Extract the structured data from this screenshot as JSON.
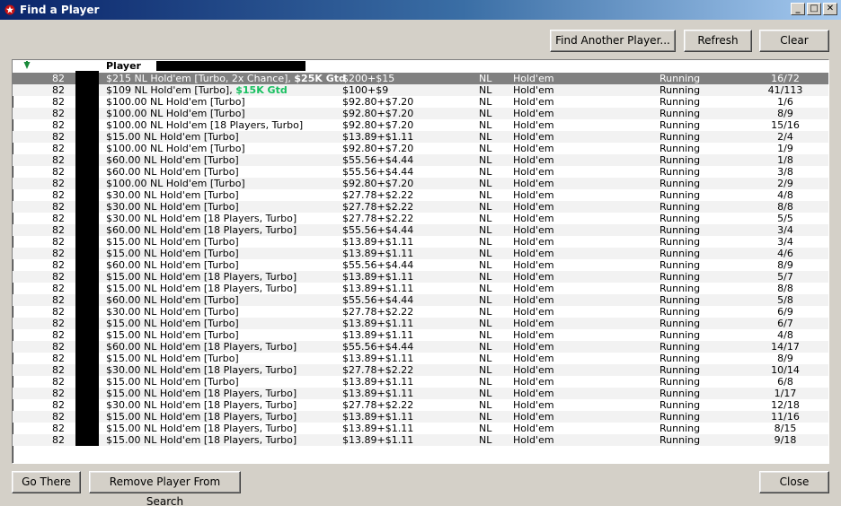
{
  "window": {
    "title": "Find a Player",
    "controls": {
      "minimize": "_",
      "maximize": "□",
      "close": "✕"
    }
  },
  "toolbar": {
    "find_another": "Find Another Player...",
    "refresh": "Refresh",
    "clear": "Clear"
  },
  "list": {
    "header": {
      "player": "Player"
    },
    "rows": [
      {
        "id": "82",
        "name": "$215 NL Hold'em [Turbo, 2x Chance],",
        "gtd": "$25K Gtd",
        "buyin": "$200+$15",
        "limit": "NL",
        "game": "Hold'em",
        "status": "Running",
        "entrants": "16/72",
        "selected": true
      },
      {
        "id": "82",
        "name": "$109 NL Hold'em [Turbo],",
        "gtd": "$15K Gtd",
        "buyin": "$100+$9",
        "limit": "NL",
        "game": "Hold'em",
        "status": "Running",
        "entrants": "41/113"
      },
      {
        "id": "82",
        "name": "$100.00 NL Hold'em [Turbo]",
        "buyin": "$92.80+$7.20",
        "limit": "NL",
        "game": "Hold'em",
        "status": "Running",
        "entrants": "1/6"
      },
      {
        "id": "82",
        "name": "$100.00 NL Hold'em [Turbo]",
        "buyin": "$92.80+$7.20",
        "limit": "NL",
        "game": "Hold'em",
        "status": "Running",
        "entrants": "8/9"
      },
      {
        "id": "82",
        "name": "$100.00 NL Hold'em [18 Players, Turbo]",
        "buyin": "$92.80+$7.20",
        "limit": "NL",
        "game": "Hold'em",
        "status": "Running",
        "entrants": "15/16"
      },
      {
        "id": "82",
        "name": "$15.00 NL Hold'em [Turbo]",
        "buyin": "$13.89+$1.11",
        "limit": "NL",
        "game": "Hold'em",
        "status": "Running",
        "entrants": "2/4"
      },
      {
        "id": "82",
        "name": "$100.00 NL Hold'em [Turbo]",
        "buyin": "$92.80+$7.20",
        "limit": "NL",
        "game": "Hold'em",
        "status": "Running",
        "entrants": "1/9"
      },
      {
        "id": "82",
        "name": "$60.00 NL Hold'em [Turbo]",
        "buyin": "$55.56+$4.44",
        "limit": "NL",
        "game": "Hold'em",
        "status": "Running",
        "entrants": "1/8"
      },
      {
        "id": "82",
        "name": "$60.00 NL Hold'em [Turbo]",
        "buyin": "$55.56+$4.44",
        "limit": "NL",
        "game": "Hold'em",
        "status": "Running",
        "entrants": "3/8"
      },
      {
        "id": "82",
        "name": "$100.00 NL Hold'em [Turbo]",
        "buyin": "$92.80+$7.20",
        "limit": "NL",
        "game": "Hold'em",
        "status": "Running",
        "entrants": "2/9"
      },
      {
        "id": "82",
        "name": "$30.00 NL Hold'em [Turbo]",
        "buyin": "$27.78+$2.22",
        "limit": "NL",
        "game": "Hold'em",
        "status": "Running",
        "entrants": "4/8"
      },
      {
        "id": "82",
        "name": "$30.00 NL Hold'em [Turbo]",
        "buyin": "$27.78+$2.22",
        "limit": "NL",
        "game": "Hold'em",
        "status": "Running",
        "entrants": "8/8"
      },
      {
        "id": "82",
        "name": "$30.00 NL Hold'em [18 Players, Turbo]",
        "buyin": "$27.78+$2.22",
        "limit": "NL",
        "game": "Hold'em",
        "status": "Running",
        "entrants": "5/5"
      },
      {
        "id": "82",
        "name": "$60.00 NL Hold'em [18 Players, Turbo]",
        "buyin": "$55.56+$4.44",
        "limit": "NL",
        "game": "Hold'em",
        "status": "Running",
        "entrants": "3/4"
      },
      {
        "id": "82",
        "name": "$15.00 NL Hold'em [Turbo]",
        "buyin": "$13.89+$1.11",
        "limit": "NL",
        "game": "Hold'em",
        "status": "Running",
        "entrants": "3/4"
      },
      {
        "id": "82",
        "name": "$15.00 NL Hold'em [Turbo]",
        "buyin": "$13.89+$1.11",
        "limit": "NL",
        "game": "Hold'em",
        "status": "Running",
        "entrants": "4/6"
      },
      {
        "id": "82",
        "name": "$60.00 NL Hold'em [Turbo]",
        "buyin": "$55.56+$4.44",
        "limit": "NL",
        "game": "Hold'em",
        "status": "Running",
        "entrants": "8/9"
      },
      {
        "id": "82",
        "name": "$15.00 NL Hold'em [18 Players, Turbo]",
        "buyin": "$13.89+$1.11",
        "limit": "NL",
        "game": "Hold'em",
        "status": "Running",
        "entrants": "5/7"
      },
      {
        "id": "82",
        "name": "$15.00 NL Hold'em [18 Players, Turbo]",
        "buyin": "$13.89+$1.11",
        "limit": "NL",
        "game": "Hold'em",
        "status": "Running",
        "entrants": "8/8"
      },
      {
        "id": "82",
        "name": "$60.00 NL Hold'em [Turbo]",
        "buyin": "$55.56+$4.44",
        "limit": "NL",
        "game": "Hold'em",
        "status": "Running",
        "entrants": "5/8"
      },
      {
        "id": "82",
        "name": "$30.00 NL Hold'em [Turbo]",
        "buyin": "$27.78+$2.22",
        "limit": "NL",
        "game": "Hold'em",
        "status": "Running",
        "entrants": "6/9"
      },
      {
        "id": "82",
        "name": "$15.00 NL Hold'em [Turbo]",
        "buyin": "$13.89+$1.11",
        "limit": "NL",
        "game": "Hold'em",
        "status": "Running",
        "entrants": "6/7"
      },
      {
        "id": "82",
        "name": "$15.00 NL Hold'em [Turbo]",
        "buyin": "$13.89+$1.11",
        "limit": "NL",
        "game": "Hold'em",
        "status": "Running",
        "entrants": "4/8"
      },
      {
        "id": "82",
        "name": "$60.00 NL Hold'em [18 Players, Turbo]",
        "buyin": "$55.56+$4.44",
        "limit": "NL",
        "game": "Hold'em",
        "status": "Running",
        "entrants": "14/17"
      },
      {
        "id": "82",
        "name": "$15.00 NL Hold'em [Turbo]",
        "buyin": "$13.89+$1.11",
        "limit": "NL",
        "game": "Hold'em",
        "status": "Running",
        "entrants": "8/9"
      },
      {
        "id": "82",
        "name": "$30.00 NL Hold'em [18 Players, Turbo]",
        "buyin": "$27.78+$2.22",
        "limit": "NL",
        "game": "Hold'em",
        "status": "Running",
        "entrants": "10/14"
      },
      {
        "id": "82",
        "name": "$15.00 NL Hold'em [Turbo]",
        "buyin": "$13.89+$1.11",
        "limit": "NL",
        "game": "Hold'em",
        "status": "Running",
        "entrants": "6/8"
      },
      {
        "id": "82",
        "name": "$15.00 NL Hold'em [18 Players, Turbo]",
        "buyin": "$13.89+$1.11",
        "limit": "NL",
        "game": "Hold'em",
        "status": "Running",
        "entrants": "1/17"
      },
      {
        "id": "82",
        "name": "$30.00 NL Hold'em [18 Players, Turbo]",
        "buyin": "$27.78+$2.22",
        "limit": "NL",
        "game": "Hold'em",
        "status": "Running",
        "entrants": "12/18"
      },
      {
        "id": "82",
        "name": "$15.00 NL Hold'em [18 Players, Turbo]",
        "buyin": "$13.89+$1.11",
        "limit": "NL",
        "game": "Hold'em",
        "status": "Running",
        "entrants": "11/16"
      },
      {
        "id": "82",
        "name": "$15.00 NL Hold'em [18 Players, Turbo]",
        "buyin": "$13.89+$1.11",
        "limit": "NL",
        "game": "Hold'em",
        "status": "Running",
        "entrants": "8/15"
      },
      {
        "id": "82",
        "name": "$15.00 NL Hold'em [18 Players, Turbo]",
        "buyin": "$13.89+$1.11",
        "limit": "NL",
        "game": "Hold'em",
        "status": "Running",
        "entrants": "9/18"
      }
    ]
  },
  "footer": {
    "go_there": "Go There",
    "remove_player": "Remove Player From Search",
    "close": "Close"
  },
  "colors": {
    "title_bar": "#0a246a",
    "selected_row": "#808080",
    "gtd_text": "#18c060",
    "dialog_bg": "#d4d0c8"
  }
}
